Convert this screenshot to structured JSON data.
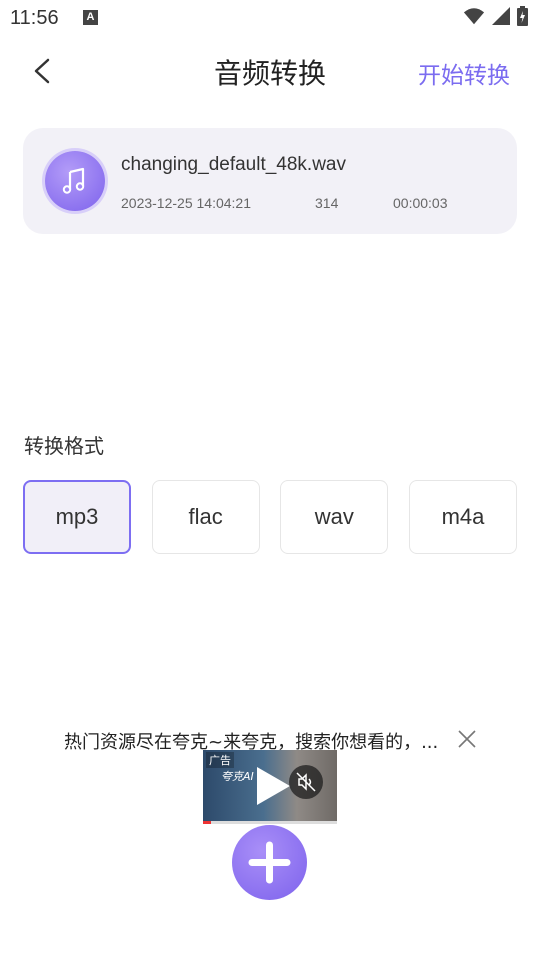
{
  "status_bar": {
    "time": "11:56",
    "notification_icon": "A"
  },
  "header": {
    "title": "音频转换",
    "action_label": "开始转换"
  },
  "file": {
    "name": "changing_default_48k.wav",
    "date": "2023-12-25 14:04:21",
    "size": "314",
    "duration": "00:00:03",
    "icon": "music-note-icon"
  },
  "format_section": {
    "label": "转换格式",
    "options": [
      "mp3",
      "flac",
      "wav",
      "m4a"
    ],
    "selected": "mp3"
  },
  "ad": {
    "text": "热门资源尽在夸克~来夸克，搜索你想看的，...",
    "tag": "广告",
    "app_name": "夸克AI"
  },
  "colors": {
    "accent": "#7b6cf0",
    "card_bg": "#f2f1f7",
    "selected_bg": "#f1eff8"
  }
}
